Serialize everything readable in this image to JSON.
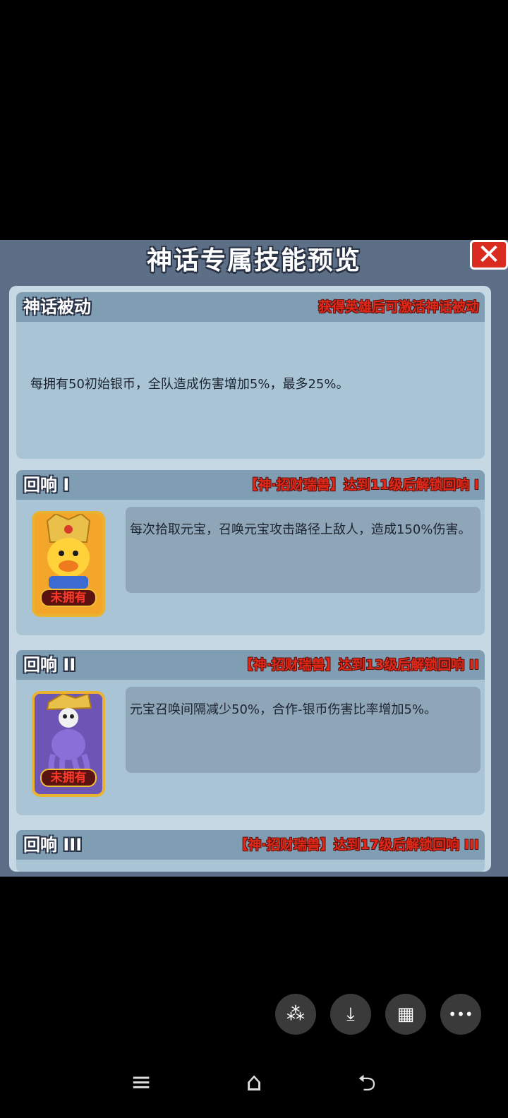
{
  "dialog": {
    "title": "神话专属技能预览",
    "close_icon": "✕"
  },
  "passive": {
    "title": "神话被动",
    "note": "获得英雄后可激活神话被动",
    "text": "每拥有50初始银币，全队造成伤害增加5%，最多25%。"
  },
  "echo1": {
    "title": "回响 I",
    "note": "【神·招财瑞兽】达到11级后解锁回响 I",
    "desc": "每次拾取元宝，召唤元宝攻击路径上敌人，造成150%伤害。",
    "badge": "未拥有"
  },
  "echo2": {
    "title": "回响 II",
    "note": "【神·招财瑞兽】达到13级后解锁回响 II",
    "desc": "元宝召唤间隔减少50%，合作-银币伤害比率增加5%。",
    "badge": "未拥有"
  },
  "echo3": {
    "title": "回响 III",
    "note": "【神·招财瑞兽】达到17级后解锁回响 III"
  },
  "floating_buttons": [
    {
      "icon": "sparkle-icon",
      "glyph": "⁂"
    },
    {
      "icon": "download-icon",
      "glyph": "⤓"
    },
    {
      "icon": "grid-icon",
      "glyph": "▦"
    },
    {
      "icon": "more-icon",
      "glyph": "•••"
    }
  ],
  "system_nav": [
    {
      "icon": "menu-icon",
      "glyph": "≡"
    },
    {
      "icon": "home-icon",
      "glyph": "⌂"
    },
    {
      "icon": "back-icon",
      "glyph": "⮌"
    }
  ],
  "colors": {
    "panel": "#5d6f86",
    "content": "#c6d8e4",
    "card": "#a9c4d5",
    "header": "#7f9db3",
    "note_red": "#e22818",
    "close_red": "#d92b1f"
  }
}
